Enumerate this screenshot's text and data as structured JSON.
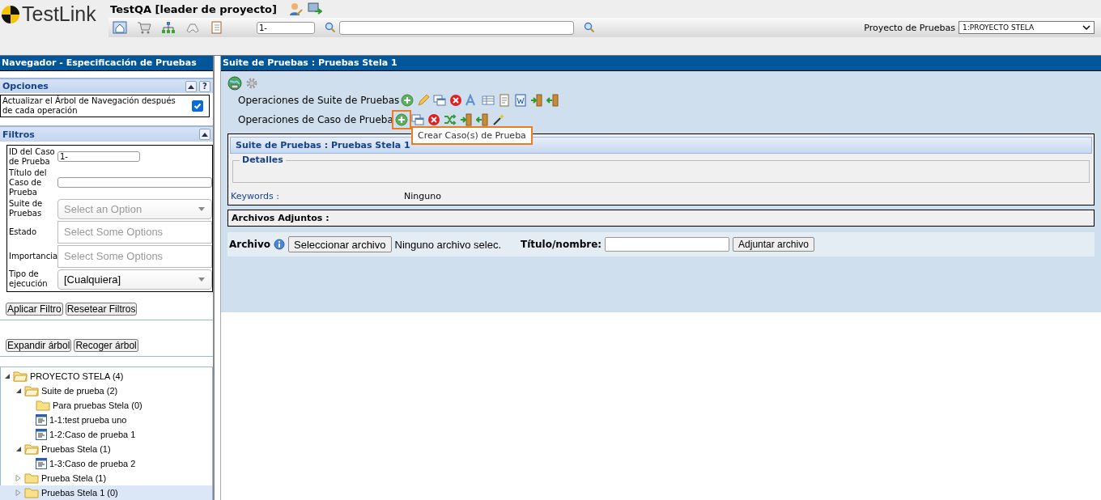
{
  "header": {
    "logo_text": "TestLink",
    "title": "TestQA [leader de proyecto]",
    "id_field": {
      "value": "1-"
    },
    "search_field": {
      "kind": "text"
    },
    "project_label": "Proyecto de Pruebas",
    "project_select": "1:PROYECTO STELA"
  },
  "navigator": {
    "title": "Navegador - Especificación de Pruebas",
    "options": {
      "title": "Opciones",
      "refresh_label": "Actualizar el Árbol de Navegación después de cada operación",
      "refresh_checked": true,
      "help_label": "?"
    },
    "filters": {
      "title": "Filtros",
      "fields": [
        {
          "kind": "input",
          "label": "ID del Caso de Prueba",
          "value": "1-"
        },
        {
          "kind": "input",
          "label": "Título del Caso de Prueba"
        },
        {
          "kind": "select",
          "label": "Suite de Pruebas",
          "placeholder": "Select an Option"
        },
        {
          "kind": "multiselect",
          "label": "Estado",
          "placeholder": "Select Some Options"
        },
        {
          "kind": "multiselect",
          "label": "Importancia",
          "placeholder": "Select Some Options"
        },
        {
          "kind": "select",
          "label": "Tipo de ejecución",
          "value": "[Cualquiera]"
        }
      ],
      "buttons": [
        "Aplicar Filtro",
        "Resetear Filtros"
      ]
    },
    "tree_buttons": [
      "Expandir árbol",
      "Recoger árbol"
    ],
    "tree": [
      {
        "kind": "folder",
        "label": "PROYECTO STELA (4)",
        "expanded": true,
        "selected": false,
        "children": [
          {
            "kind": "folder",
            "label": "Suite de prueba (2)",
            "expanded": true,
            "selected": false,
            "children": [
              {
                "kind": "folder",
                "label": "Para pruebas Stela (0)",
                "selected": false
              },
              {
                "kind": "testcase",
                "label": "1-1:test prueba uno",
                "selected": false
              },
              {
                "kind": "testcase",
                "label": "1-2:Caso de prueba 1",
                "selected": false
              }
            ]
          },
          {
            "kind": "folder",
            "label": "Pruebas Stela (1)",
            "expanded": true,
            "selected": false,
            "children": [
              {
                "kind": "testcase",
                "label": "1-3:Caso de prueba 2",
                "selected": false
              }
            ]
          },
          {
            "kind": "folder",
            "label": "Prueba Stela (1)",
            "expanded": false,
            "selected": false
          },
          {
            "kind": "folder",
            "label": "Pruebas Stela 1 (0)",
            "expanded": false,
            "selected": true
          }
        ]
      }
    ]
  },
  "main": {
    "title": "Suite de Pruebas : Pruebas Stela 1",
    "operations": [
      {
        "kind": "suite",
        "label": "Operaciones de Suite de Pruebas"
      },
      {
        "kind": "case",
        "label": "Operaciones de Caso de Prueba"
      }
    ],
    "tooltip": "Crear Caso(s) de Prueba",
    "details": {
      "title": "Suite de Pruebas : Pruebas Stela 1",
      "legend": "Detalles",
      "keywords_label": "Keywords :",
      "keywords_value": "Ninguno"
    },
    "attachments": {
      "title": "Archivos Adjuntos :",
      "file_label": "Archivo",
      "choose_button": "Seleccionar archivo",
      "no_file": "Ninguno archivo selec.",
      "name_label": "Título/nombre:",
      "name_field": {
        "kind": "text"
      },
      "upload_button": "Adjuntar archivo"
    }
  }
}
